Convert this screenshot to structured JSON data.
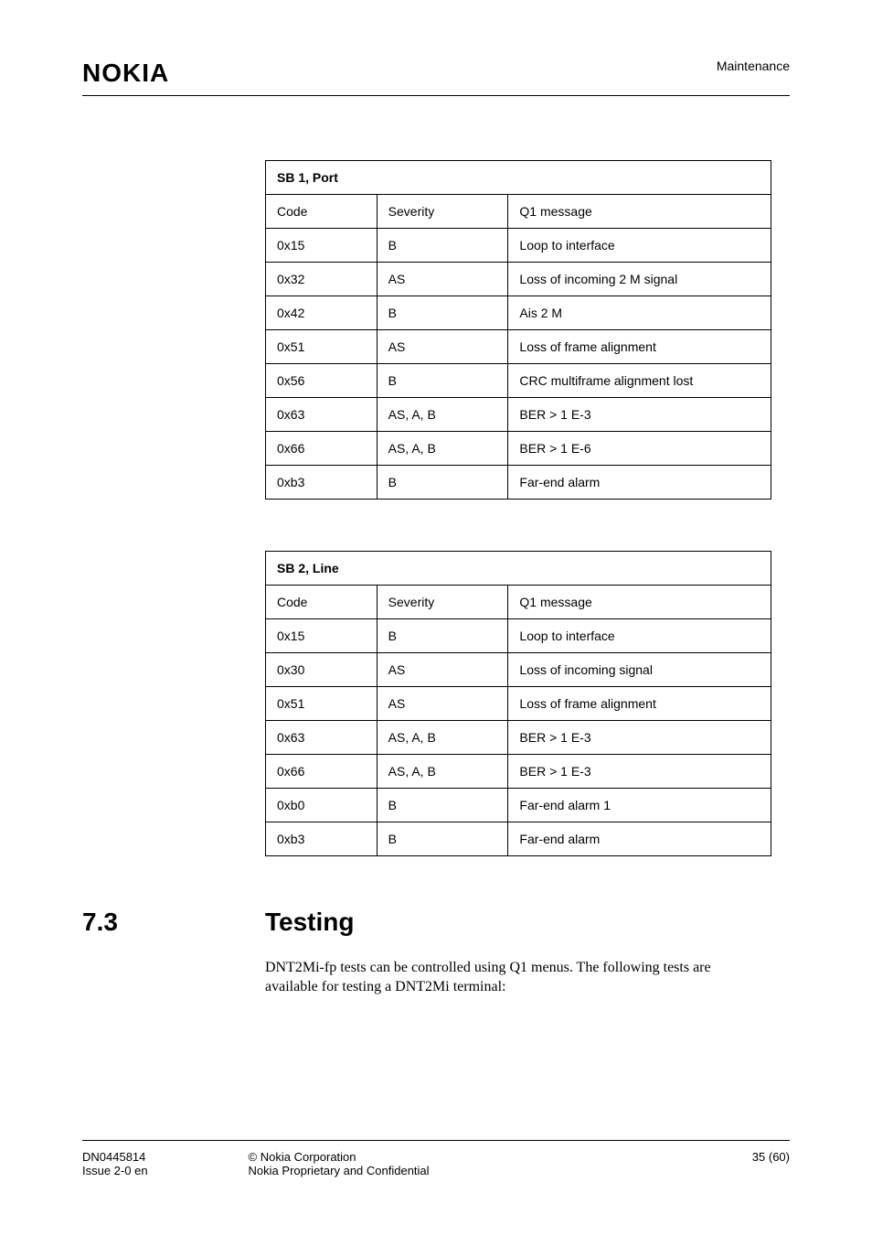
{
  "header": {
    "logo": "NOKIA",
    "breadcrumb": "Maintenance"
  },
  "tables": {
    "t1": {
      "title": "SB 1, Port",
      "cols": [
        "Code",
        "Severity",
        "Q1 message"
      ],
      "rows": [
        [
          "0x15",
          "B",
          "Loop to interface"
        ],
        [
          "0x32",
          "AS",
          "Loss of incoming 2 M signal"
        ],
        [
          "0x42",
          "B",
          "Ais 2 M"
        ],
        [
          "0x51",
          "AS",
          "Loss of frame alignment"
        ],
        [
          "0x56",
          "B",
          "CRC multiframe alignment lost"
        ],
        [
          "0x63",
          "AS, A, B",
          "BER > 1 E-3"
        ],
        [
          "0x66",
          "AS, A, B",
          "BER > 1 E-6"
        ],
        [
          "0xb3",
          "B",
          "Far-end alarm"
        ]
      ]
    },
    "t2": {
      "title": "SB 2, Line",
      "cols": [
        "Code",
        "Severity",
        "Q1 message"
      ],
      "rows": [
        [
          "0x15",
          "B",
          "Loop to interface"
        ],
        [
          "0x30",
          "AS",
          "Loss of incoming signal"
        ],
        [
          "0x51",
          "AS",
          "Loss of frame alignment"
        ],
        [
          "0x63",
          "AS, A, B",
          "BER > 1 E-3"
        ],
        [
          "0x66",
          "AS, A, B",
          "BER > 1 E-3"
        ],
        [
          "0xb0",
          "B",
          "Far-end alarm 1"
        ],
        [
          "0xb3",
          "B",
          "Far-end alarm"
        ]
      ]
    }
  },
  "section": {
    "num": "7.3",
    "title": "Testing"
  },
  "body": {
    "p1": "DNT2Mi-fp tests can be controlled using Q1 menus. The following tests are available for testing a DNT2Mi terminal:"
  },
  "footer": {
    "left1": "DN0445814",
    "left2": "Issue 2-0 en",
    "center1": "© Nokia Corporation",
    "center2": "Nokia Proprietary and Confidential",
    "right": "35 (60)"
  }
}
